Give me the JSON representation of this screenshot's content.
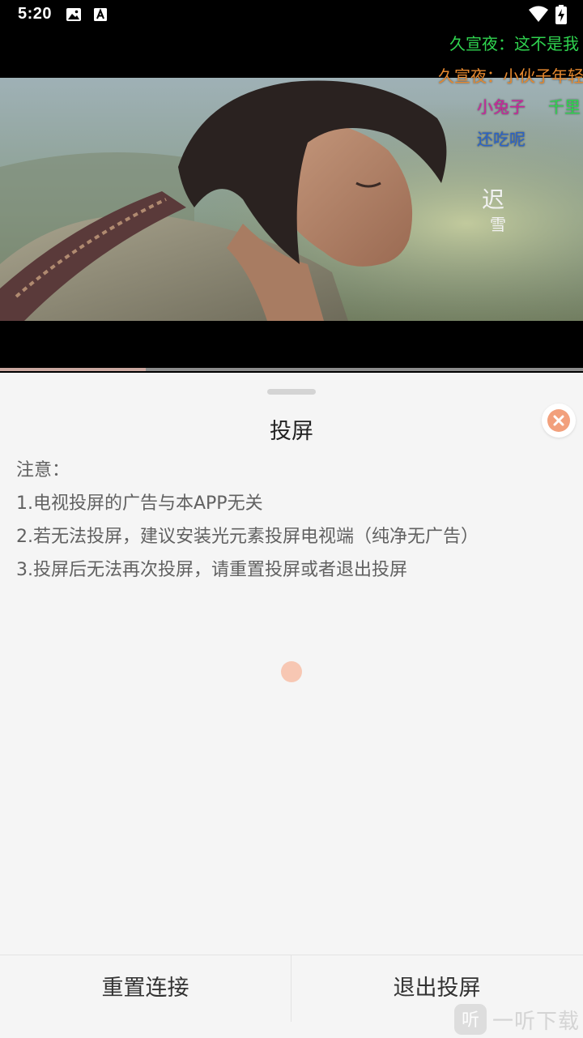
{
  "status_bar": {
    "time": "5:20",
    "icons": [
      "image-icon",
      "text-a-icon",
      "wifi-icon",
      "battery-charging-icon"
    ]
  },
  "video": {
    "caption_glyphs": [
      "迟",
      "雪"
    ],
    "danmaku": [
      {
        "text": "久宣夜：这不是我",
        "color": "#2fd34f"
      },
      {
        "text": "久宣夜：小伙子年轻",
        "color": "#e6892f"
      },
      {
        "text": "小兔子",
        "color": "#c9259b"
      },
      {
        "text": "千里",
        "color": "#2fd34f"
      },
      {
        "text": "还吃呢",
        "color": "#2a63c9"
      }
    ],
    "progress": 0.25
  },
  "sheet": {
    "title": "投屏",
    "notes": [
      "注意：",
      "1.电视投屏的广告与本APP无关",
      "2.若无法投屏，建议安装光元素投屏电视端（纯净无广告）",
      "3.投屏后无法再次投屏，请重置投屏或者退出投屏"
    ],
    "buttons": {
      "reset": "重置连接",
      "exit": "退出投屏"
    }
  },
  "watermark": {
    "logo_glyph": "听",
    "text": "一听下载"
  },
  "colors": {
    "accent": "#f2a07c",
    "loading": "#f7c7b3"
  }
}
